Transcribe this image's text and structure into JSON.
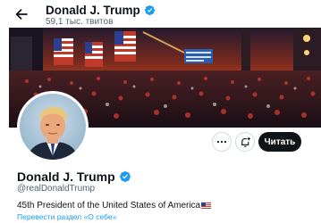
{
  "header": {
    "back_icon": "arrow-left-icon",
    "name": "Donald J. Trump",
    "tweet_count": "59,1 тыс. твитов"
  },
  "profile": {
    "name": "Donald J. Trump",
    "handle": "@realDonaldTrump",
    "bio": "45th President of the United States of America",
    "bio_emoji": "us-flag-icon",
    "translate_link": "Перевести раздел «О себе»",
    "verified_icon": "verified-badge-icon"
  },
  "actions": {
    "more_icon": "more-horizontal-icon",
    "notify_icon": "bell-plus-icon",
    "follow_label": "Читать"
  },
  "colors": {
    "accent": "#1d9bf0",
    "text": "#0f1419",
    "muted": "#536471",
    "follow_bg": "#0f1419"
  }
}
